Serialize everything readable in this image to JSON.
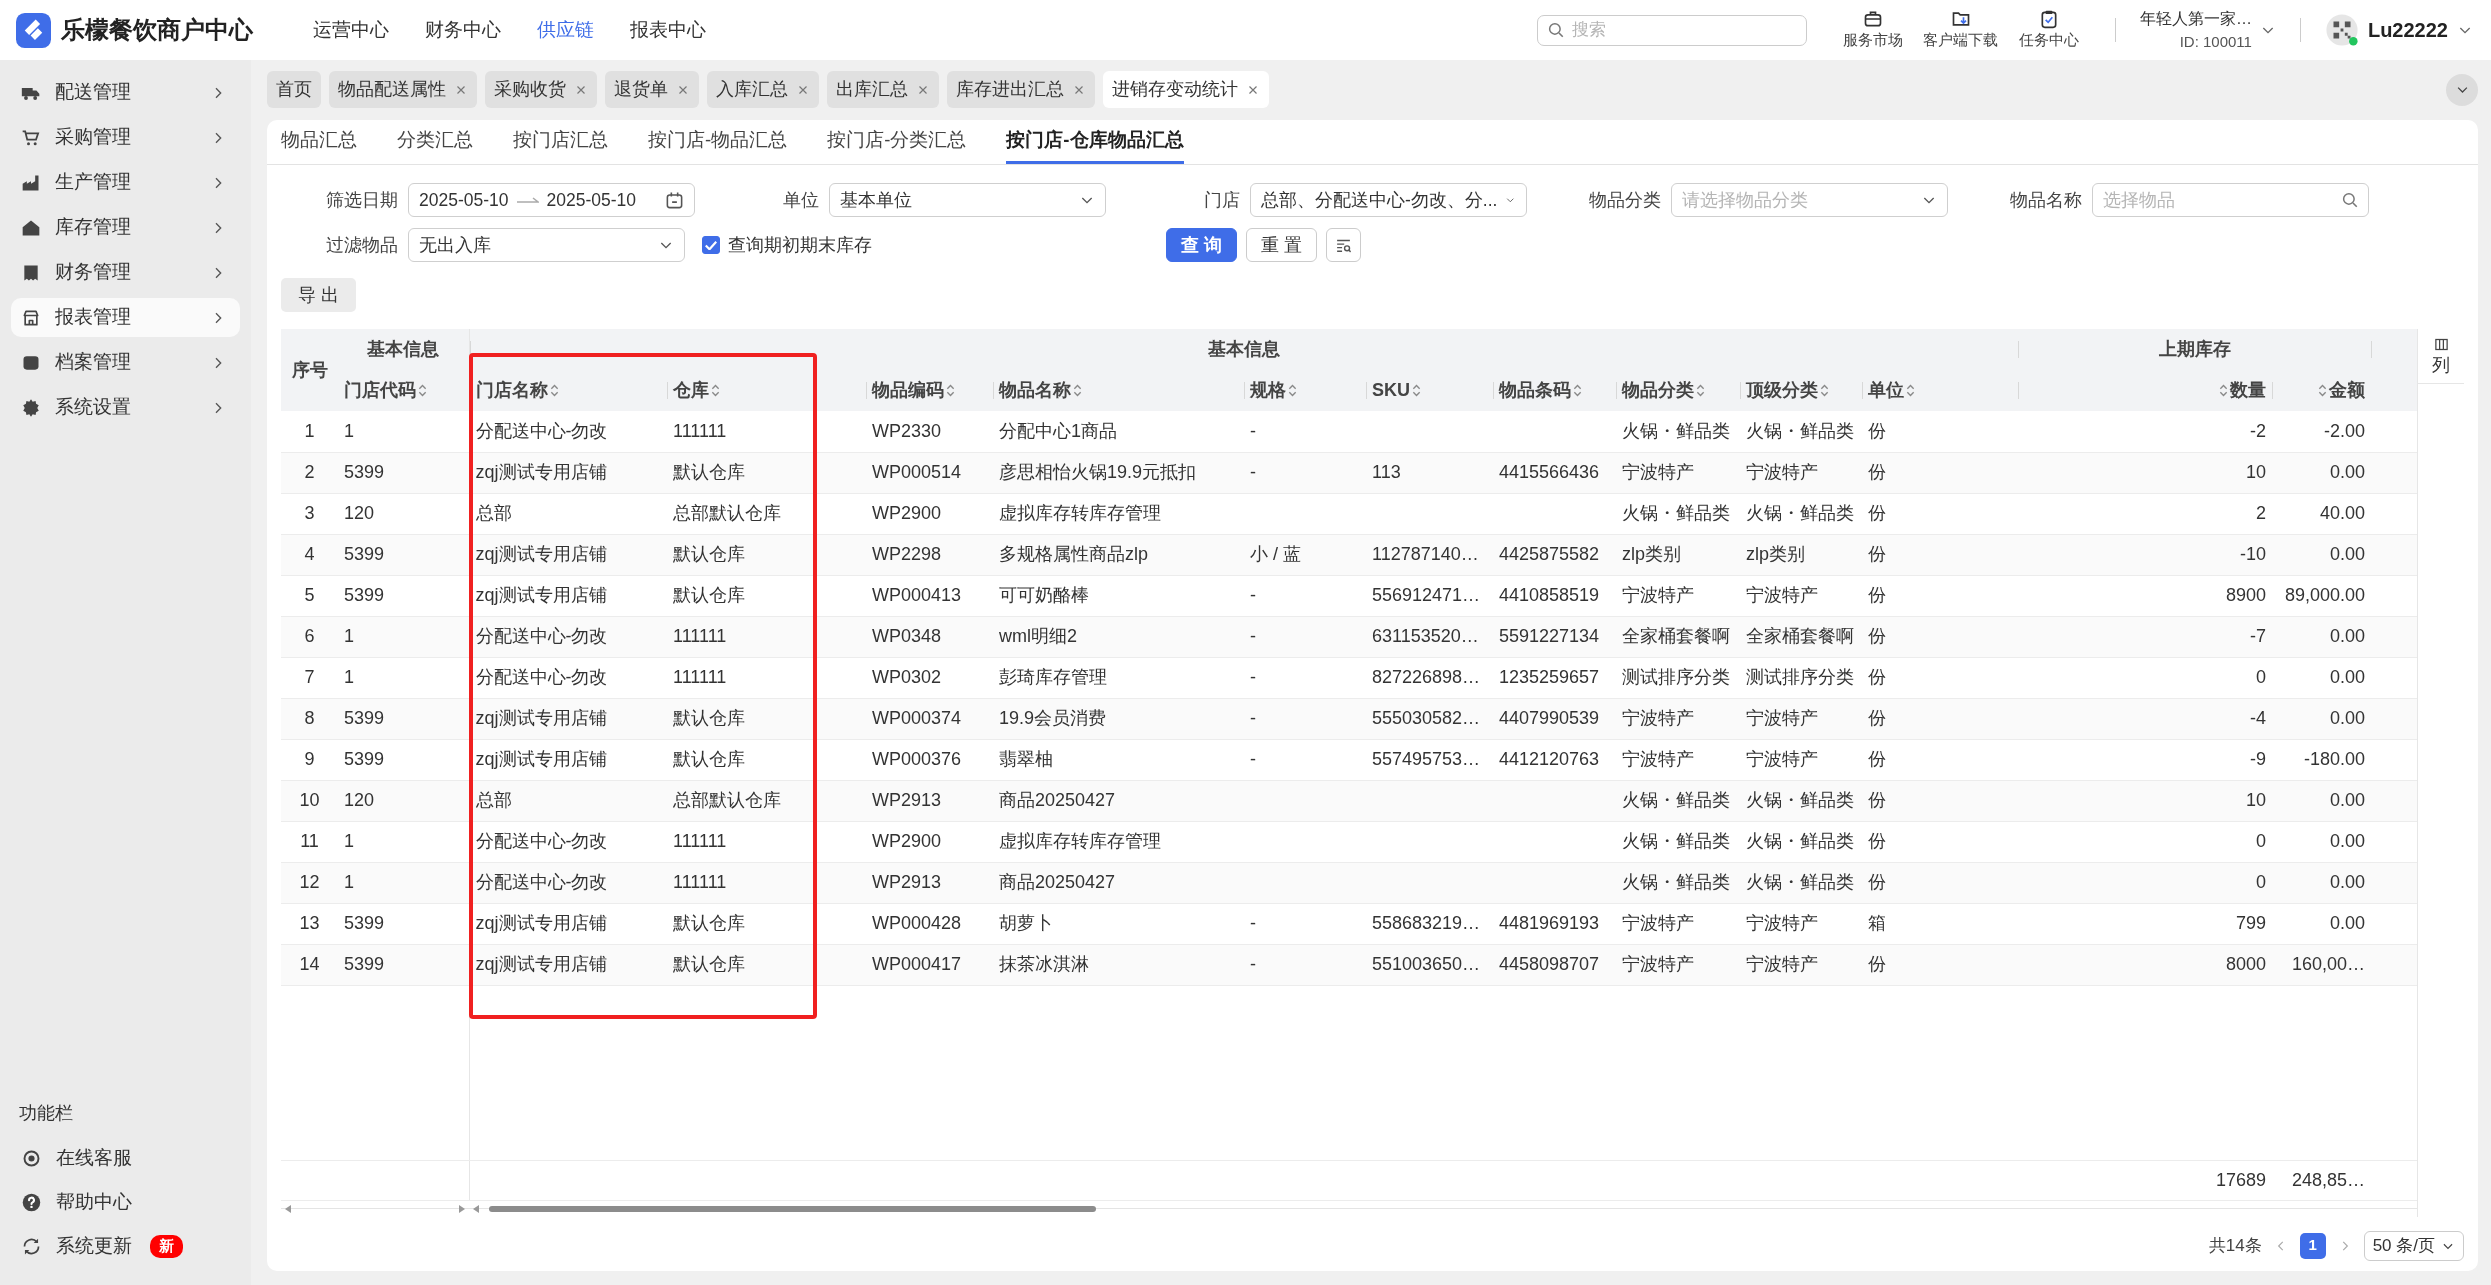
{
  "app": {
    "title": "乐檬餐饮商户中心"
  },
  "top_nav": [
    {
      "label": "运营中心",
      "selected": false
    },
    {
      "label": "财务中心",
      "selected": false
    },
    {
      "label": "供应链",
      "selected": true
    },
    {
      "label": "报表中心",
      "selected": false
    }
  ],
  "search": {
    "placeholder": "搜索"
  },
  "tools": [
    {
      "label": "服务市场"
    },
    {
      "label": "客户端下载"
    },
    {
      "label": "任务中心"
    }
  ],
  "account": {
    "name": "年轻人第一家…",
    "id": "ID: 100011"
  },
  "user": {
    "name": "Lu22222"
  },
  "sidebar": {
    "items": [
      {
        "label": "配送管理",
        "selected": false
      },
      {
        "label": "采购管理",
        "selected": false
      },
      {
        "label": "生产管理",
        "selected": false
      },
      {
        "label": "库存管理",
        "selected": false
      },
      {
        "label": "财务管理",
        "selected": false
      },
      {
        "label": "报表管理",
        "selected": true
      },
      {
        "label": "档案管理",
        "selected": false
      },
      {
        "label": "系统设置",
        "selected": false
      }
    ],
    "section_title": "功能栏",
    "tools": [
      {
        "label": "在线客服"
      },
      {
        "label": "帮助中心"
      },
      {
        "label": "系统更新",
        "badge": "新"
      }
    ]
  },
  "page_tabs": [
    {
      "label": "首页",
      "closable": false,
      "selected": false
    },
    {
      "label": "物品配送属性",
      "closable": true,
      "selected": false
    },
    {
      "label": "采购收货",
      "closable": true,
      "selected": false
    },
    {
      "label": "退货单",
      "closable": true,
      "selected": false
    },
    {
      "label": "入库汇总",
      "closable": true,
      "selected": false
    },
    {
      "label": "出库汇总",
      "closable": true,
      "selected": false
    },
    {
      "label": "库存进出汇总",
      "closable": true,
      "selected": false
    },
    {
      "label": "进销存变动统计",
      "closable": true,
      "selected": true
    }
  ],
  "sub_tabs": [
    {
      "label": "物品汇总",
      "selected": false
    },
    {
      "label": "分类汇总",
      "selected": false
    },
    {
      "label": "按门店汇总",
      "selected": false
    },
    {
      "label": "按门店-物品汇总",
      "selected": false
    },
    {
      "label": "按门店-分类汇总",
      "selected": false
    },
    {
      "label": "按门店-仓库物品汇总",
      "selected": true
    }
  ],
  "filters": [
    {
      "kind": "date_range",
      "label": "筛选日期",
      "start": "2025-05-10",
      "end": "2025-05-10"
    },
    {
      "kind": "select",
      "label": "单位",
      "value": "基本单位"
    },
    {
      "kind": "select",
      "label": "门店",
      "value": "总部、分配送中心-勿改、分..."
    },
    {
      "kind": "select",
      "label": "物品分类",
      "placeholder": "请选择物品分类"
    },
    {
      "kind": "search",
      "label": "物品名称",
      "placeholder": "选择物品"
    },
    {
      "kind": "select",
      "label": "过滤物品",
      "value": "无出入库"
    },
    {
      "kind": "checkbox",
      "label": "查询期初期末库存",
      "checked": true
    }
  ],
  "actions": [
    {
      "kind": "primary",
      "label": "查 询"
    },
    {
      "kind": "default",
      "label": "重 置"
    },
    {
      "kind": "icon"
    }
  ],
  "export": {
    "label": "导 出"
  },
  "table": {
    "header_groups": [
      {
        "kind": "column",
        "label": "序号",
        "sortable": false
      },
      {
        "kind": "group",
        "label": "基本信息",
        "columns": [
          {
            "label": "门店代码",
            "sortable": true
          }
        ]
      },
      {
        "kind": "group",
        "label": "基本信息",
        "columns": [
          {
            "label": "门店名称",
            "sortable": true
          },
          {
            "label": "仓库",
            "sortable": true
          },
          {
            "label": "物品编码",
            "sortable": true
          },
          {
            "label": "物品名称",
            "sortable": true
          },
          {
            "label": "规格",
            "sortable": true
          },
          {
            "label": "SKU",
            "sortable": true
          },
          {
            "label": "物品条码",
            "sortable": true
          },
          {
            "label": "物品分类",
            "sortable": true
          },
          {
            "label": "顶级分类",
            "sortable": true
          },
          {
            "label": "单位",
            "sortable": true
          }
        ]
      },
      {
        "kind": "group",
        "label": "上期库存",
        "columns": [
          {
            "label": "数量",
            "sortable": true
          },
          {
            "label": "金额",
            "sortable": true
          }
        ]
      }
    ],
    "rows": [
      [
        "1",
        "1",
        "分配送中心-勿改",
        "111111",
        "WP2330",
        "分配中心1商品",
        "-",
        null,
        null,
        "火锅・鲜品类",
        "火锅・鲜品类",
        "份",
        "-2",
        "-2.00"
      ],
      [
        "2",
        "5399",
        "zqj测试专用店铺",
        "默认仓库",
        "WP000514",
        "彦思相怡火锅19.9元抵扣",
        "-",
        "113",
        "4415566436",
        "宁波特产",
        "宁波特产",
        "份",
        "10",
        "0.00"
      ],
      [
        "3",
        "120",
        "总部",
        "总部默认仓库",
        "WP2900",
        "虚拟库存转库存管理",
        null,
        null,
        null,
        "火锅・鲜品类",
        "火锅・鲜品类",
        "份",
        "2",
        "40.00"
      ],
      [
        "4",
        "5399",
        "zqj测试专用店铺",
        "默认仓库",
        "WP2298",
        "多规格属性商品zlp",
        "小 / 蓝",
        "112787140…",
        "4425875582",
        "zlp类别",
        "zlp类别",
        "份",
        "-10",
        "0.00"
      ],
      [
        "5",
        "5399",
        "zqj测试专用店铺",
        "默认仓库",
        "WP000413",
        "可可奶酪棒",
        "-",
        "556912471…",
        "4410858519",
        "宁波特产",
        "宁波特产",
        "份",
        "8900",
        "89,000.00"
      ],
      [
        "6",
        "1",
        "分配送中心-勿改",
        "111111",
        "WP0348",
        "wml明细2",
        "-",
        "631153520…",
        "5591227134",
        "全家桶套餐啊",
        "全家桶套餐啊",
        "份",
        "-7",
        "0.00"
      ],
      [
        "7",
        "1",
        "分配送中心-勿改",
        "111111",
        "WP0302",
        "彭琦库存管理",
        "-",
        "827226898…",
        "1235259657",
        "测试排序分类",
        "测试排序分类",
        "份",
        "0",
        "0.00"
      ],
      [
        "8",
        "5399",
        "zqj测试专用店铺",
        "默认仓库",
        "WP000374",
        "19.9会员消费",
        "-",
        "555030582…",
        "4407990539",
        "宁波特产",
        "宁波特产",
        "份",
        "-4",
        "0.00"
      ],
      [
        "9",
        "5399",
        "zqj测试专用店铺",
        "默认仓库",
        "WP000376",
        "翡翠柚",
        "-",
        "557495753…",
        "4412120763",
        "宁波特产",
        "宁波特产",
        "份",
        "-9",
        "-180.00"
      ],
      [
        "10",
        "120",
        "总部",
        "总部默认仓库",
        "WP2913",
        "商品20250427",
        null,
        null,
        null,
        "火锅・鲜品类",
        "火锅・鲜品类",
        "份",
        "10",
        "0.00"
      ],
      [
        "11",
        "1",
        "分配送中心-勿改",
        "111111",
        "WP2900",
        "虚拟库存转库存管理",
        null,
        null,
        null,
        "火锅・鲜品类",
        "火锅・鲜品类",
        "份",
        "0",
        "0.00"
      ],
      [
        "12",
        "1",
        "分配送中心-勿改",
        "111111",
        "WP2913",
        "商品20250427",
        null,
        null,
        null,
        "火锅・鲜品类",
        "火锅・鲜品类",
        "份",
        "0",
        "0.00"
      ],
      [
        "13",
        "5399",
        "zqj测试专用店铺",
        "默认仓库",
        "WP000428",
        "胡萝卜",
        "-",
        "558683219…",
        "4481969193",
        "宁波特产",
        "宁波特产",
        "箱",
        "799",
        "0.00"
      ],
      [
        "14",
        "5399",
        "zqj测试专用店铺",
        "默认仓库",
        "WP000417",
        "抹茶冰淇淋",
        "-",
        "551003650…",
        "4458098707",
        "宁波特产",
        "宁波特产",
        "份",
        "8000",
        "160,00…"
      ]
    ],
    "summary": {
      "quantity_total": "17689",
      "amount_total": "248,85…"
    }
  },
  "column_settings": {
    "label": "列"
  },
  "pagination": {
    "total": "共14条",
    "pages": [
      {
        "label": "1",
        "selected": true
      }
    ],
    "page_size": "50 条/页"
  }
}
